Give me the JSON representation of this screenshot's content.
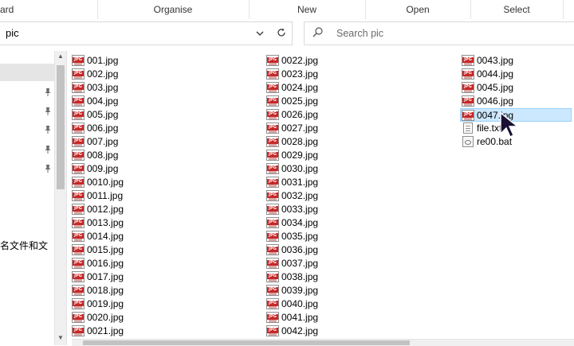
{
  "ribbon": {
    "groups": [
      "ard",
      "Organise",
      "New",
      "Open",
      "Select"
    ]
  },
  "address": {
    "path": "pic",
    "chevron": "chevron-down-icon",
    "refresh": "refresh-icon"
  },
  "search": {
    "placeholder": "Search pic",
    "icon": "search-icon"
  },
  "nav": {
    "cut_text": "名文件和文",
    "pins": [
      "pin-icon",
      "pin-icon",
      "pin-icon",
      "pin-icon",
      "pin-icon"
    ]
  },
  "files": {
    "columns": [
      [
        "001.jpg",
        "002.jpg",
        "003.jpg",
        "004.jpg",
        "005.jpg",
        "006.jpg",
        "007.jpg",
        "008.jpg",
        "009.jpg",
        "0010.jpg",
        "0011.jpg",
        "0012.jpg",
        "0013.jpg",
        "0014.jpg",
        "0015.jpg",
        "0016.jpg",
        "0017.jpg",
        "0018.jpg",
        "0019.jpg",
        "0020.jpg",
        "0021.jpg"
      ],
      [
        "0022.jpg",
        "0023.jpg",
        "0024.jpg",
        "0025.jpg",
        "0026.jpg",
        "0027.jpg",
        "0028.jpg",
        "0029.jpg",
        "0030.jpg",
        "0031.jpg",
        "0032.jpg",
        "0033.jpg",
        "0034.jpg",
        "0035.jpg",
        "0036.jpg",
        "0037.jpg",
        "0038.jpg",
        "0039.jpg",
        "0040.jpg",
        "0041.jpg",
        "0042.jpg"
      ],
      [
        "0043.jpg",
        "0044.jpg",
        "0045.jpg",
        "0046.jpg",
        "0047.jpg",
        "file.txt",
        "re00.bat"
      ]
    ],
    "selected": "0047.jpg",
    "jpg_tag": "JPG",
    "colors": {
      "selection_bg": "#cce8ff",
      "selection_border": "#99d1ff",
      "jpg_badge": "#c62828"
    }
  }
}
